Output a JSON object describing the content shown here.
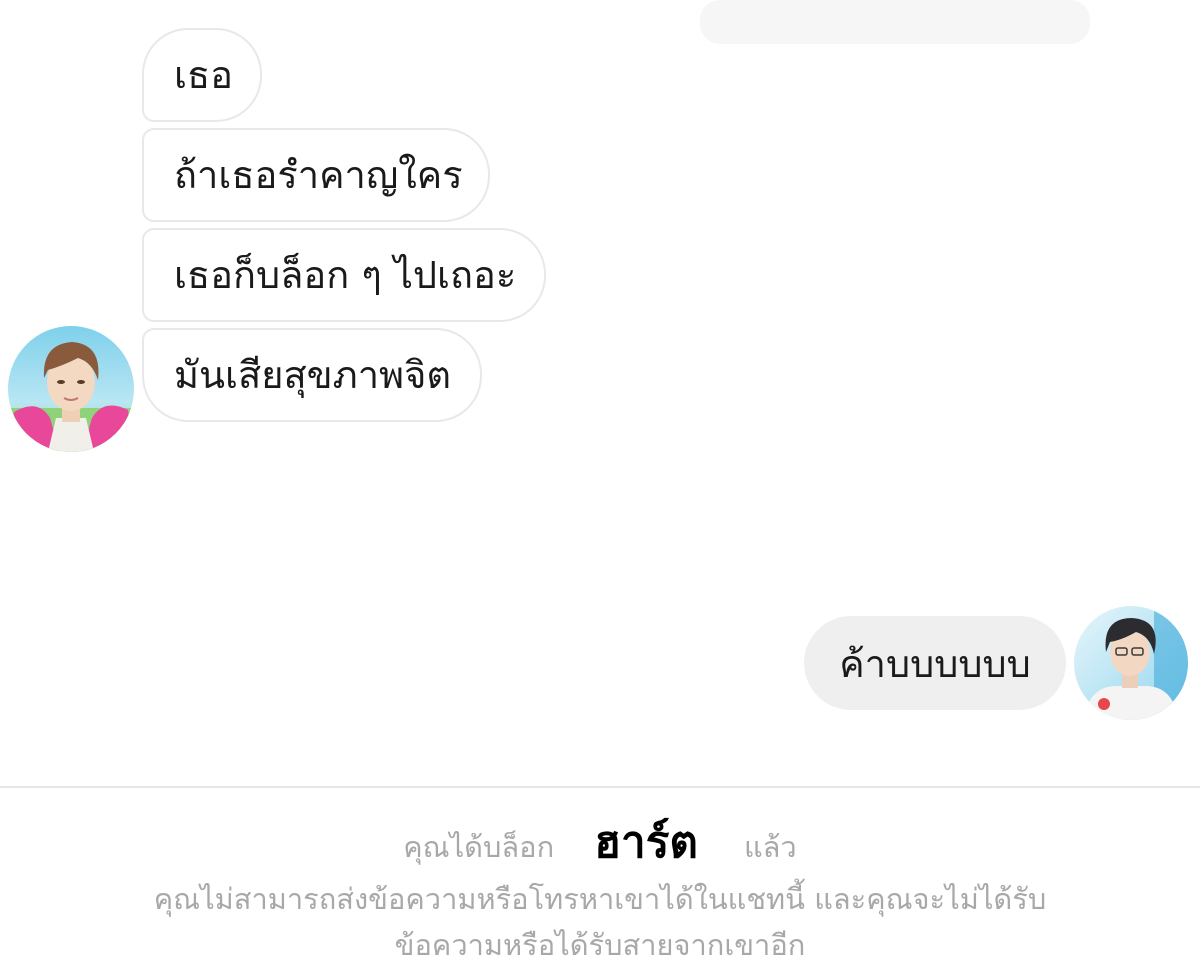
{
  "conversation": {
    "incoming_messages": [
      {
        "text": "เธอ"
      },
      {
        "text": "ถ้าเธอรำคาญใคร"
      },
      {
        "text": "เธอก็บล็อก ๆ ไปเถอะ"
      },
      {
        "text": "มันเสียสุขภาพจิต"
      }
    ],
    "outgoing_messages": [
      {
        "text": "ค้าบบบบบบ"
      }
    ]
  },
  "blocked_notice": {
    "prefix": "คุณได้บล็อก",
    "name": "ฮาร์ต",
    "suffix": "แล้ว",
    "line2": "คุณไม่สามารถส่งข้อความหรือโทรหาเขาได้ในแชทนี้ และคุณจะไม่ได้รับ",
    "line3": "ข้อความหรือได้รับสายจากเขาอีก"
  },
  "colors": {
    "incoming_bubble_bg": "#ffffff",
    "incoming_bubble_border": "#e8e8e8",
    "outgoing_bubble_bg": "#efefef",
    "notice_text": "#a8a8a8",
    "name_text": "#000000",
    "avatar_left_accent": "#e8479a",
    "avatar_right_accent": "#3aa8d8"
  },
  "icons": {
    "avatar_left": "contact-avatar-illustration",
    "avatar_right": "user-avatar-illustration"
  }
}
